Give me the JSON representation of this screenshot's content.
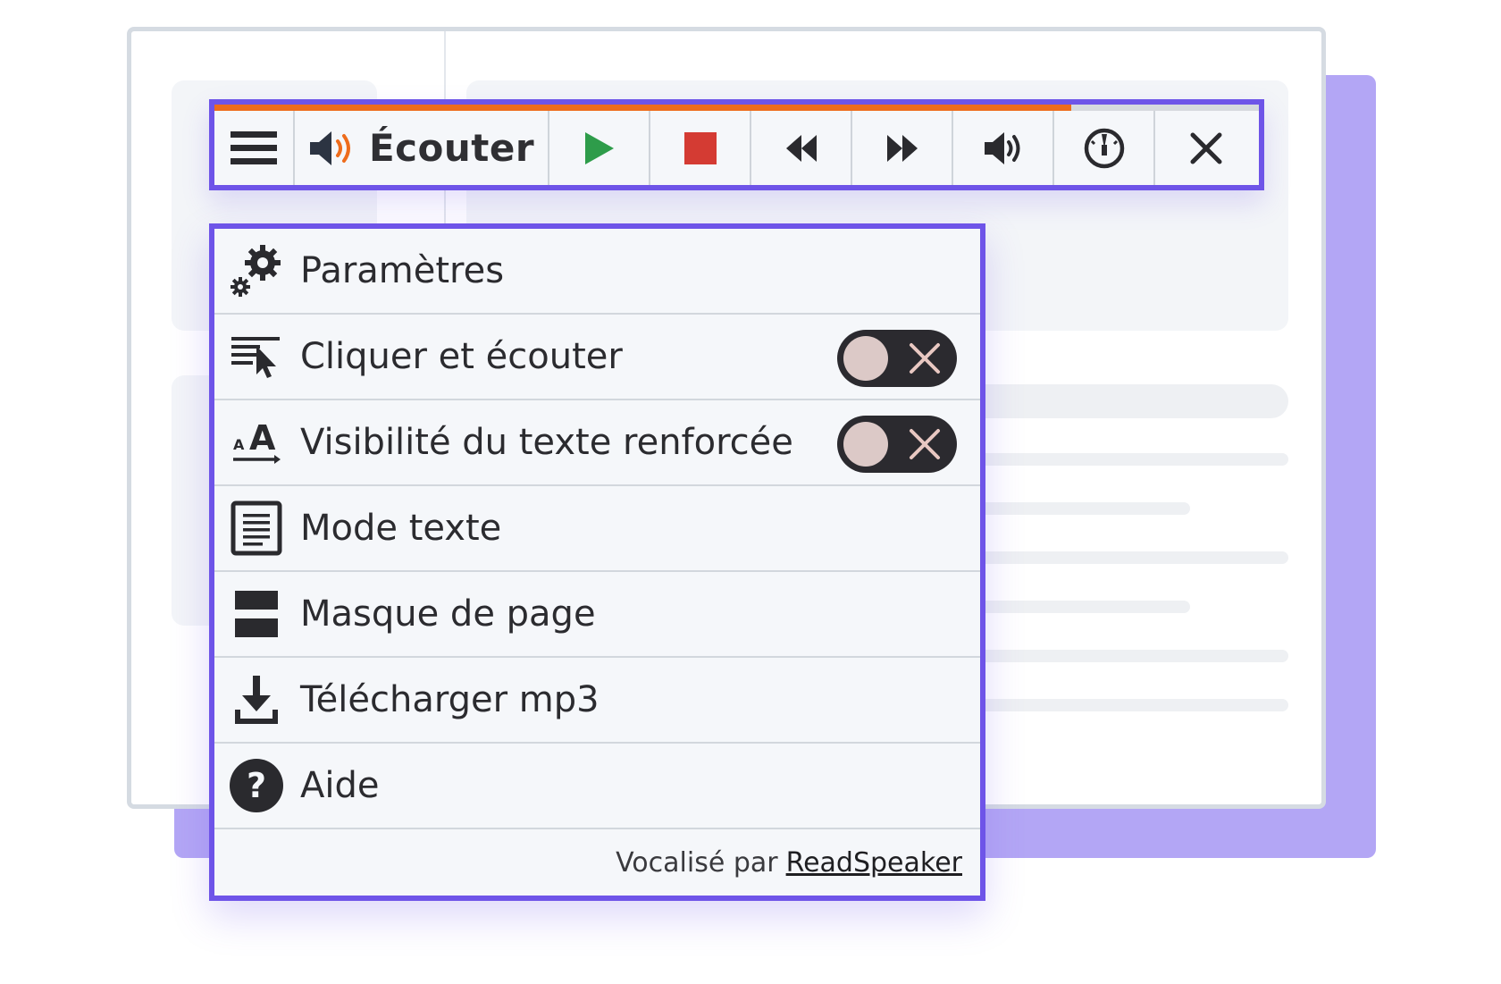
{
  "toolbar": {
    "progress_percent": 82,
    "menu_icon": "hamburger-menu-icon",
    "listen_label": "Écouter",
    "listen_icon": "speaker-sound-icon",
    "play_icon": "play-icon",
    "stop_icon": "stop-icon",
    "rewind_icon": "rewind-icon",
    "forward_icon": "fast-forward-icon",
    "volume_icon": "volume-icon",
    "speed_icon": "speedometer-icon",
    "close_icon": "close-icon"
  },
  "menu": {
    "items": [
      {
        "label": "Paramètres",
        "icon": "settings-gears-icon"
      },
      {
        "label": "Cliquer et écouter",
        "icon": "click-listen-icon",
        "toggle": "off"
      },
      {
        "label": "Visibilité du texte renforcée",
        "icon": "text-enlarge-icon",
        "toggle": "off"
      },
      {
        "label": "Mode texte",
        "icon": "text-document-icon"
      },
      {
        "label": "Masque de page",
        "icon": "page-mask-icon"
      },
      {
        "label": "Télécharger mp3",
        "icon": "download-icon"
      },
      {
        "label": "Aide",
        "icon": "help-icon"
      }
    ],
    "footer_prefix": "Vocalisé par",
    "footer_link": "ReadSpeaker"
  },
  "colors": {
    "accent": "#6e54e8",
    "progress": "#ee6c1c",
    "play": "#2e9c4a",
    "stop": "#d43b33",
    "backdrop": "#b3a6f5"
  }
}
